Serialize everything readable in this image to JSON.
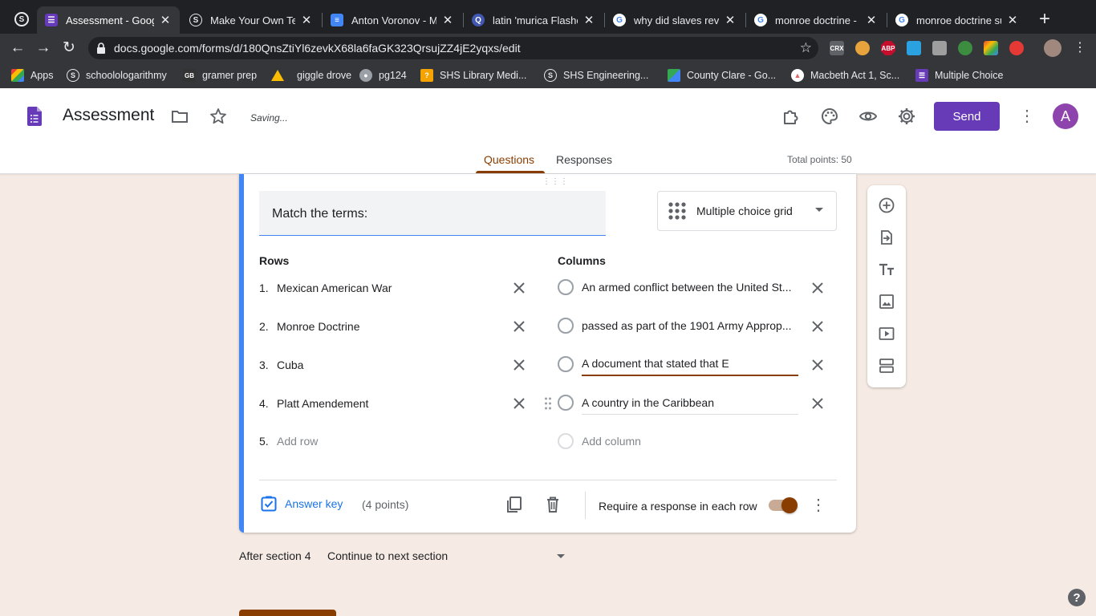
{
  "browser": {
    "tabs": [
      {
        "title": "Assessment - Goog",
        "icon": "forms-icon",
        "color": "#673ab7",
        "active": true
      },
      {
        "title": "Make Your Own Tes",
        "icon": "schoology-icon",
        "color": "#1a73e8"
      },
      {
        "title": "Anton Voronov - Ma",
        "icon": "docs-icon",
        "color": "#4285f4"
      },
      {
        "title": "latin 'murica Flashc",
        "icon": "quizlet-icon",
        "color": "#4257b2"
      },
      {
        "title": "why did slaves revo",
        "icon": "google-icon",
        "color": "#ffffff"
      },
      {
        "title": "monroe doctrine - C",
        "icon": "google-icon",
        "color": "#ffffff"
      },
      {
        "title": "monroe doctrine su",
        "icon": "google-icon",
        "color": "#ffffff"
      }
    ],
    "new_tab_label": "+",
    "url": "docs.google.com/forms/d/180QnsZtiYl6zevkX68la6faGK323QrsujZZ4jE2yqxs/edit",
    "extensions": [
      {
        "name": "crx-icon",
        "label": "CRX",
        "color": "#5f6368"
      },
      {
        "name": "owl-icon",
        "label": "",
        "color": "#e8a33d"
      },
      {
        "name": "abp-icon",
        "label": "ABP",
        "color": "#c70d2c"
      },
      {
        "name": "bird-icon",
        "label": "",
        "color": "#2aa1e0"
      },
      {
        "name": "briefcase-icon",
        "label": "",
        "color": "#9e9e9e"
      },
      {
        "name": "leaf-icon",
        "label": "",
        "color": "#3c8d3f"
      },
      {
        "name": "color-picker-icon",
        "label": "",
        "color": "#7e57c2"
      },
      {
        "name": "pen-icon",
        "label": "",
        "color": "#e53935"
      }
    ]
  },
  "bookmarks": [
    {
      "label": "Apps",
      "icon": "apps-grid-icon",
      "color": "#ea4335"
    },
    {
      "label": "schoolologarithmy",
      "icon": "schoology-icon",
      "color": "#1a73e8"
    },
    {
      "label": "gramer prep",
      "icon": "gb-icon",
      "color": "#333333"
    },
    {
      "label": "giggle drove",
      "icon": "drive-icon",
      "color": "#fbbc04"
    },
    {
      "label": "pg124",
      "icon": "globe-icon",
      "color": "#9aa0a6"
    },
    {
      "label": "SHS Library Medi...",
      "icon": "library-icon",
      "color": "#f4a300"
    },
    {
      "label": "SHS Engineering...",
      "icon": "schoology-icon",
      "color": "#1a73e8"
    },
    {
      "label": "County Clare - Go...",
      "icon": "maps-icon",
      "color": "#34a853"
    },
    {
      "label": "Macbeth Act 1, Sc...",
      "icon": "shaker-icon",
      "color": "#e06666"
    },
    {
      "label": "Multiple Choice",
      "icon": "forms-icon",
      "color": "#673ab7"
    }
  ],
  "form": {
    "title": "Assessment",
    "status": "Saving...",
    "send_label": "Send",
    "avatar_letter": "A",
    "tabs": [
      {
        "label": "Questions",
        "active": true
      },
      {
        "label": "Responses",
        "active": false
      }
    ],
    "total_points": "Total points: 50",
    "accent_color": "#8a3d00",
    "brand_color": "#673ab7"
  },
  "question": {
    "title": "Match the terms:",
    "type": "Multiple choice grid",
    "rows_label": "Rows",
    "columns_label": "Columns",
    "rows": [
      {
        "num": "1.",
        "text": "Mexican American War"
      },
      {
        "num": "2.",
        "text": "Monroe Doctrine"
      },
      {
        "num": "3.",
        "text": "Cuba"
      },
      {
        "num": "4.",
        "text": "Platt Amendement"
      }
    ],
    "add_row": {
      "num": "5.",
      "text": "Add row"
    },
    "columns": [
      {
        "text": "An armed conflict between the United St..."
      },
      {
        "text": "passed as part of the 1901 Army Approp..."
      },
      {
        "text": "A document that stated that E"
      },
      {
        "text": "A country in the Caribbean"
      }
    ],
    "add_column": "Add column",
    "answer_key": "Answer key",
    "points": "(4 points)",
    "require_label": "Require a response in each row",
    "require_on": true
  },
  "section_nav": {
    "after_label": "After section 4",
    "action": "Continue to next section"
  },
  "help_label": "?"
}
